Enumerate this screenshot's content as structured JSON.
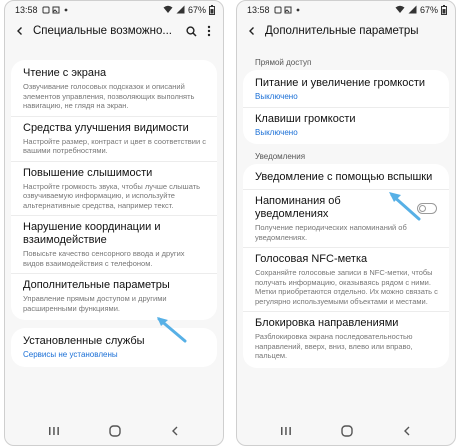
{
  "left": {
    "status": {
      "time": "13:58",
      "battery": "67%"
    },
    "title": "Специальные возможно...",
    "items": [
      {
        "title": "Чтение с экрана",
        "desc": "Озвучивание голосовых подсказок и описаний элементов управления, позволяющих выполнять навигацию, не глядя на экран."
      },
      {
        "title": "Средства улучшения видимости",
        "desc": "Настройте размер, контраст и цвет в соответствии с вашими потребностями."
      },
      {
        "title": "Повышение слышимости",
        "desc": "Настройте громкость звука, чтобы лучше слышать озвучиваемую информацию, и используйте альтернативные средства, например текст."
      },
      {
        "title": "Нарушение координации и взаимодействие",
        "desc": "Повысьте качество сенсорного ввода и других видов взаимодействия с телефоном."
      },
      {
        "title": "Дополнительные параметры",
        "desc": "Управление прямым доступом и другими расширенными функциями."
      }
    ],
    "installed": {
      "title": "Установленные службы",
      "desc": "Сервисы не установлены"
    }
  },
  "right": {
    "status": {
      "time": "13:58",
      "battery": "67%"
    },
    "title": "Дополнительные параметры",
    "section1": "Прямой доступ",
    "direct": [
      {
        "title": "Питание и увеличение громкости",
        "desc": "Выключено"
      },
      {
        "title": "Клавиши громкости",
        "desc": "Выключено"
      }
    ],
    "section2": "Уведомления",
    "notifications": [
      {
        "title": "Уведомление с помощью вспышки",
        "desc": ""
      },
      {
        "title": "Напоминания об уведомлениях",
        "desc": "Получение периодических напоминаний об уведомлениях."
      },
      {
        "title": "Голосовая NFC-метка",
        "desc": "Сохраняйте голосовые записи в NFC-метки, чтобы получать информацию, оказываясь рядом с ними. Метки приобретаются отдельно. Их можно связать с регулярно используемыми объектами и местами."
      },
      {
        "title": "Блокировка направлениями",
        "desc": "Разблокировка экрана последовательностью направлений, вверх, вниз, влево или вправо, пальцем."
      }
    ]
  }
}
